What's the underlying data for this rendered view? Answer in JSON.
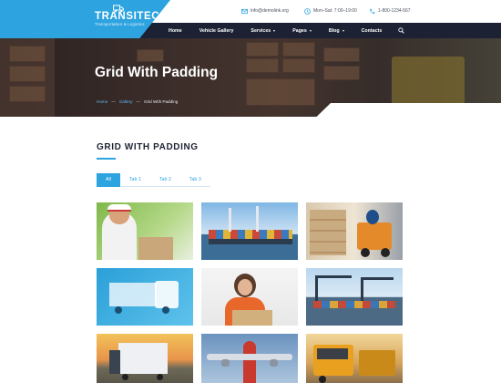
{
  "brand": {
    "name": "TRANSITEC",
    "tagline": "Transportation & Logistics",
    "logo_icon": "truck-icon",
    "accent": "#2da3e0"
  },
  "contacts": {
    "email": "info@demolink.org",
    "hours": "Mon–Sat: 7:00–19:00",
    "phone": "1-800-1234-567"
  },
  "nav": {
    "items": [
      {
        "label": "Home",
        "dropdown": false
      },
      {
        "label": "Vehicle Gallery",
        "dropdown": false
      },
      {
        "label": "Services",
        "dropdown": true
      },
      {
        "label": "Pages",
        "dropdown": true
      },
      {
        "label": "Blog",
        "dropdown": true
      },
      {
        "label": "Contacts",
        "dropdown": false
      }
    ],
    "search_icon": "search-icon",
    "background": "#1c2133"
  },
  "hero": {
    "title": "Grid With Padding",
    "breadcrumb": [
      "Home",
      "Gallery",
      "Grid With Padding"
    ]
  },
  "section": {
    "title": "GRID WITH PADDING"
  },
  "tabs": [
    {
      "label": "All",
      "active": true
    },
    {
      "label": "Tab 1",
      "active": false
    },
    {
      "label": "Tab 2",
      "active": false
    },
    {
      "label": "Tab 3",
      "active": false
    }
  ],
  "gallery": [
    {
      "subject": "courier"
    },
    {
      "subject": "container-port"
    },
    {
      "subject": "forklift-warehouse"
    },
    {
      "subject": "blue-truck"
    },
    {
      "subject": "woman-with-box"
    },
    {
      "subject": "port-cranes"
    },
    {
      "subject": "truck-sunset"
    },
    {
      "subject": "airplane"
    },
    {
      "subject": "yellow-trucks"
    }
  ]
}
